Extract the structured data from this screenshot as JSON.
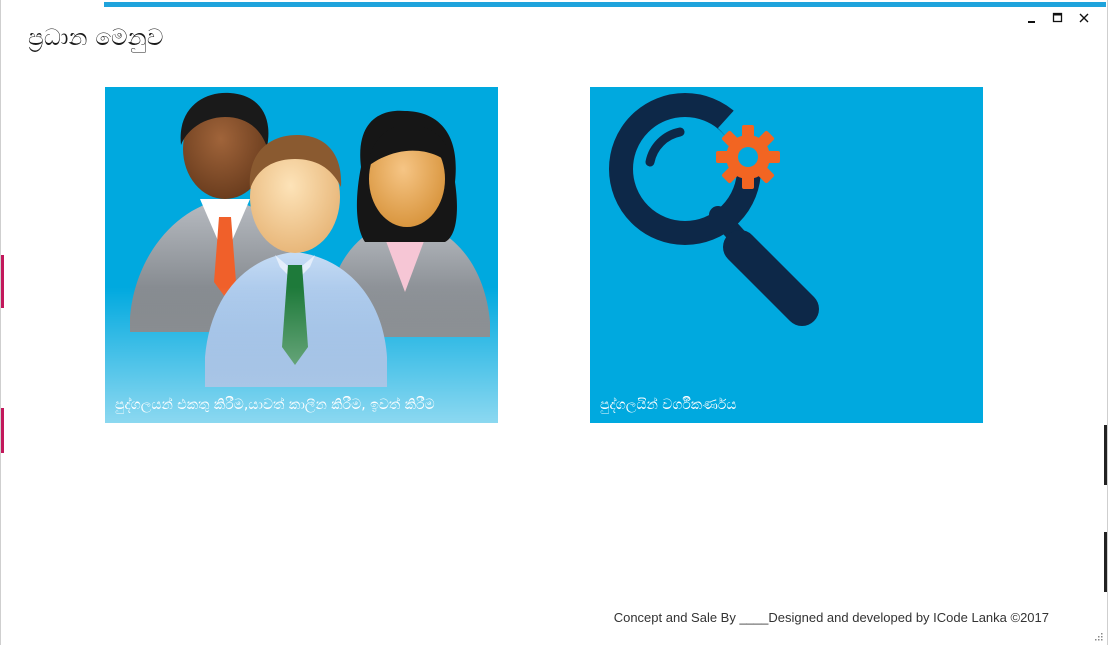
{
  "window": {
    "title": "ප්‍රධාන මෙනුව",
    "controls": {
      "minimize_icon": "minimize-icon",
      "maximize_icon": "maximize-icon",
      "close_icon": "close-icon"
    }
  },
  "tiles": [
    {
      "label": "පුද්ගලයන් එකතු කිරීම,යාවත් කාලීන කිරීම, ඉවත් කිරීම",
      "icon": "people-group-icon"
    },
    {
      "label": "පුද්ගලයින් වර්ගීකර්ණය",
      "icon": "search-gear-icon"
    }
  ],
  "footer": {
    "credit": "Concept and Sale By ____Designed and developed by ICode Lanka ©2017"
  },
  "colors": {
    "tile_background": "#00a9df",
    "accent_top": "#1fa3dc",
    "accent_left": "#c2185b",
    "gear": "#f26522",
    "magnifier": "#0d2848"
  }
}
